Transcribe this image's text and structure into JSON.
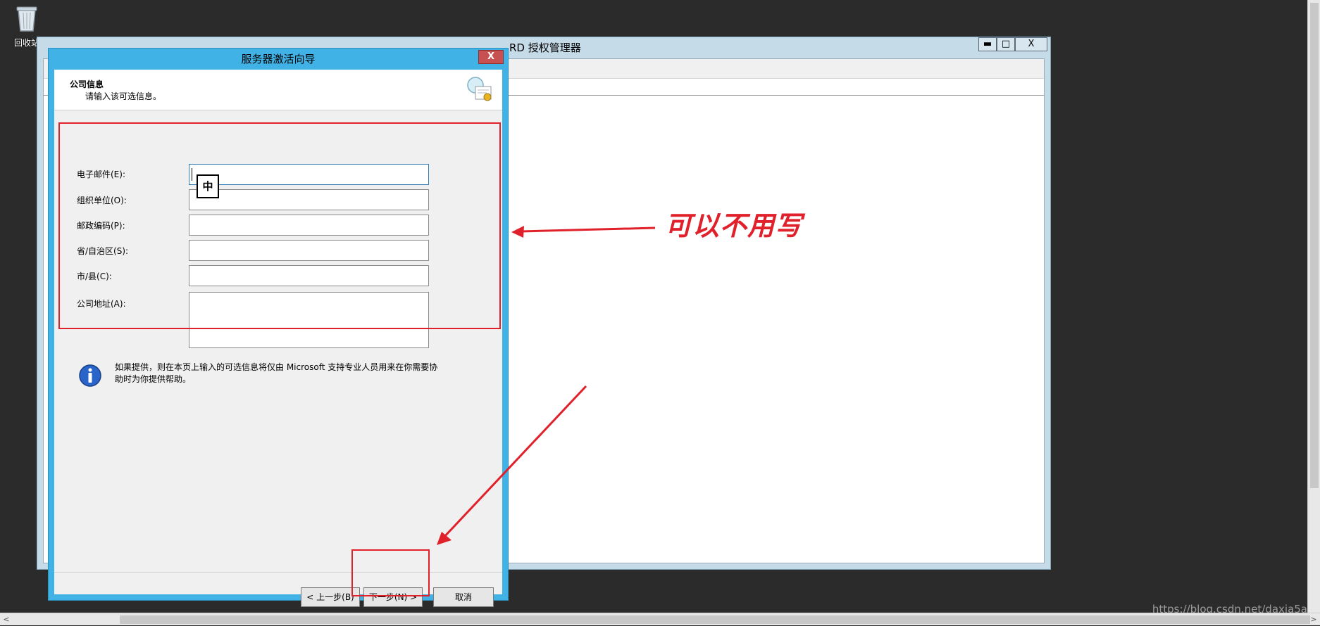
{
  "desktop": {
    "recycle_bin_label": "回收站"
  },
  "main_window": {
    "title": "RD 授权管理器",
    "controls": {
      "minimize": "▬",
      "maximize": "□",
      "close": "X"
    }
  },
  "dialog": {
    "title": "服务器激活向导",
    "close": "X",
    "header_title": "公司信息",
    "header_subtitle": "请输入该可选信息。",
    "fields": [
      {
        "label": "电子邮件(E):",
        "value": ""
      },
      {
        "label": "组织单位(O):",
        "value": ""
      },
      {
        "label": "邮政编码(P):",
        "value": ""
      },
      {
        "label": "省/自治区(S):",
        "value": ""
      },
      {
        "label": "市/县(C):",
        "value": ""
      },
      {
        "label": "公司地址(A):",
        "value": ""
      }
    ],
    "ime_indicator": "中",
    "info_text": "如果提供，则在本页上输入的可选信息将仅由 Microsoft 支持专业人员用来在你需要协助时为你提供帮助。",
    "buttons": {
      "back": "< 上一步(B)",
      "next": "下一步(N) >",
      "cancel": "取消"
    }
  },
  "annotation": {
    "text": "可以不用写",
    "color": "#e0202a"
  },
  "watermark": "https://blog.csdn.net/daxia5a",
  "scrollbar": {
    "left_arrow": "<",
    "right_arrow": ">"
  }
}
